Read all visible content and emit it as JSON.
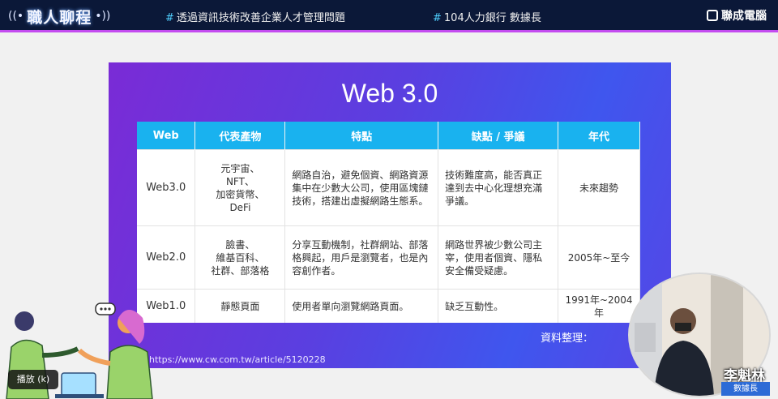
{
  "topbar": {
    "show_name": "職人聊程",
    "tag1": "透過資訊技術改善企業人才管理問題",
    "tag2": "104人力銀行 數據長",
    "brand": "聯成電腦"
  },
  "slide": {
    "title": "Web 3.0",
    "table": {
      "headers": [
        "Web",
        "代表產物",
        "特點",
        "缺點 / 爭議",
        "年代"
      ],
      "rows": [
        {
          "web": "Web3.0",
          "products": [
            "元宇宙、",
            "NFT、",
            "加密貨幣、",
            "DeFi"
          ],
          "features": "網路自治，避免個資、網路資源集中在少數大公司，使用區塊鏈技術，搭建出虛擬網路生態系。",
          "cons": "技術難度高，能否真正達到去中心化理想充滿爭議。",
          "era": "未來趨勢"
        },
        {
          "web": "Web2.0",
          "products": [
            "臉書、",
            "維基百科、",
            "社群、部落格"
          ],
          "features": "分享互動機制，社群網站、部落格興起，用戶是瀏覽者，也是內容創作者。",
          "cons": "網路世界被少數公司主宰，使用者個資、隱私安全備受疑慮。",
          "era": "2005年~至今"
        },
        {
          "web": "Web1.0",
          "products": [
            "靜態頁面"
          ],
          "features": "使用者單向瀏覽網路頁面。",
          "cons": "缺乏互動性。",
          "era": "1991年~2004年"
        }
      ]
    },
    "source_label": "資料整理：",
    "url": "https://www.cw.com.tw/article/5120228"
  },
  "speaker": {
    "name": "李魁林",
    "role": "數據長"
  },
  "player": {
    "play_label": "播放 (k)"
  },
  "colors": {
    "header_bg": "#0b1838",
    "accent": "#c44cf0",
    "table_header": "#19b2ef"
  }
}
